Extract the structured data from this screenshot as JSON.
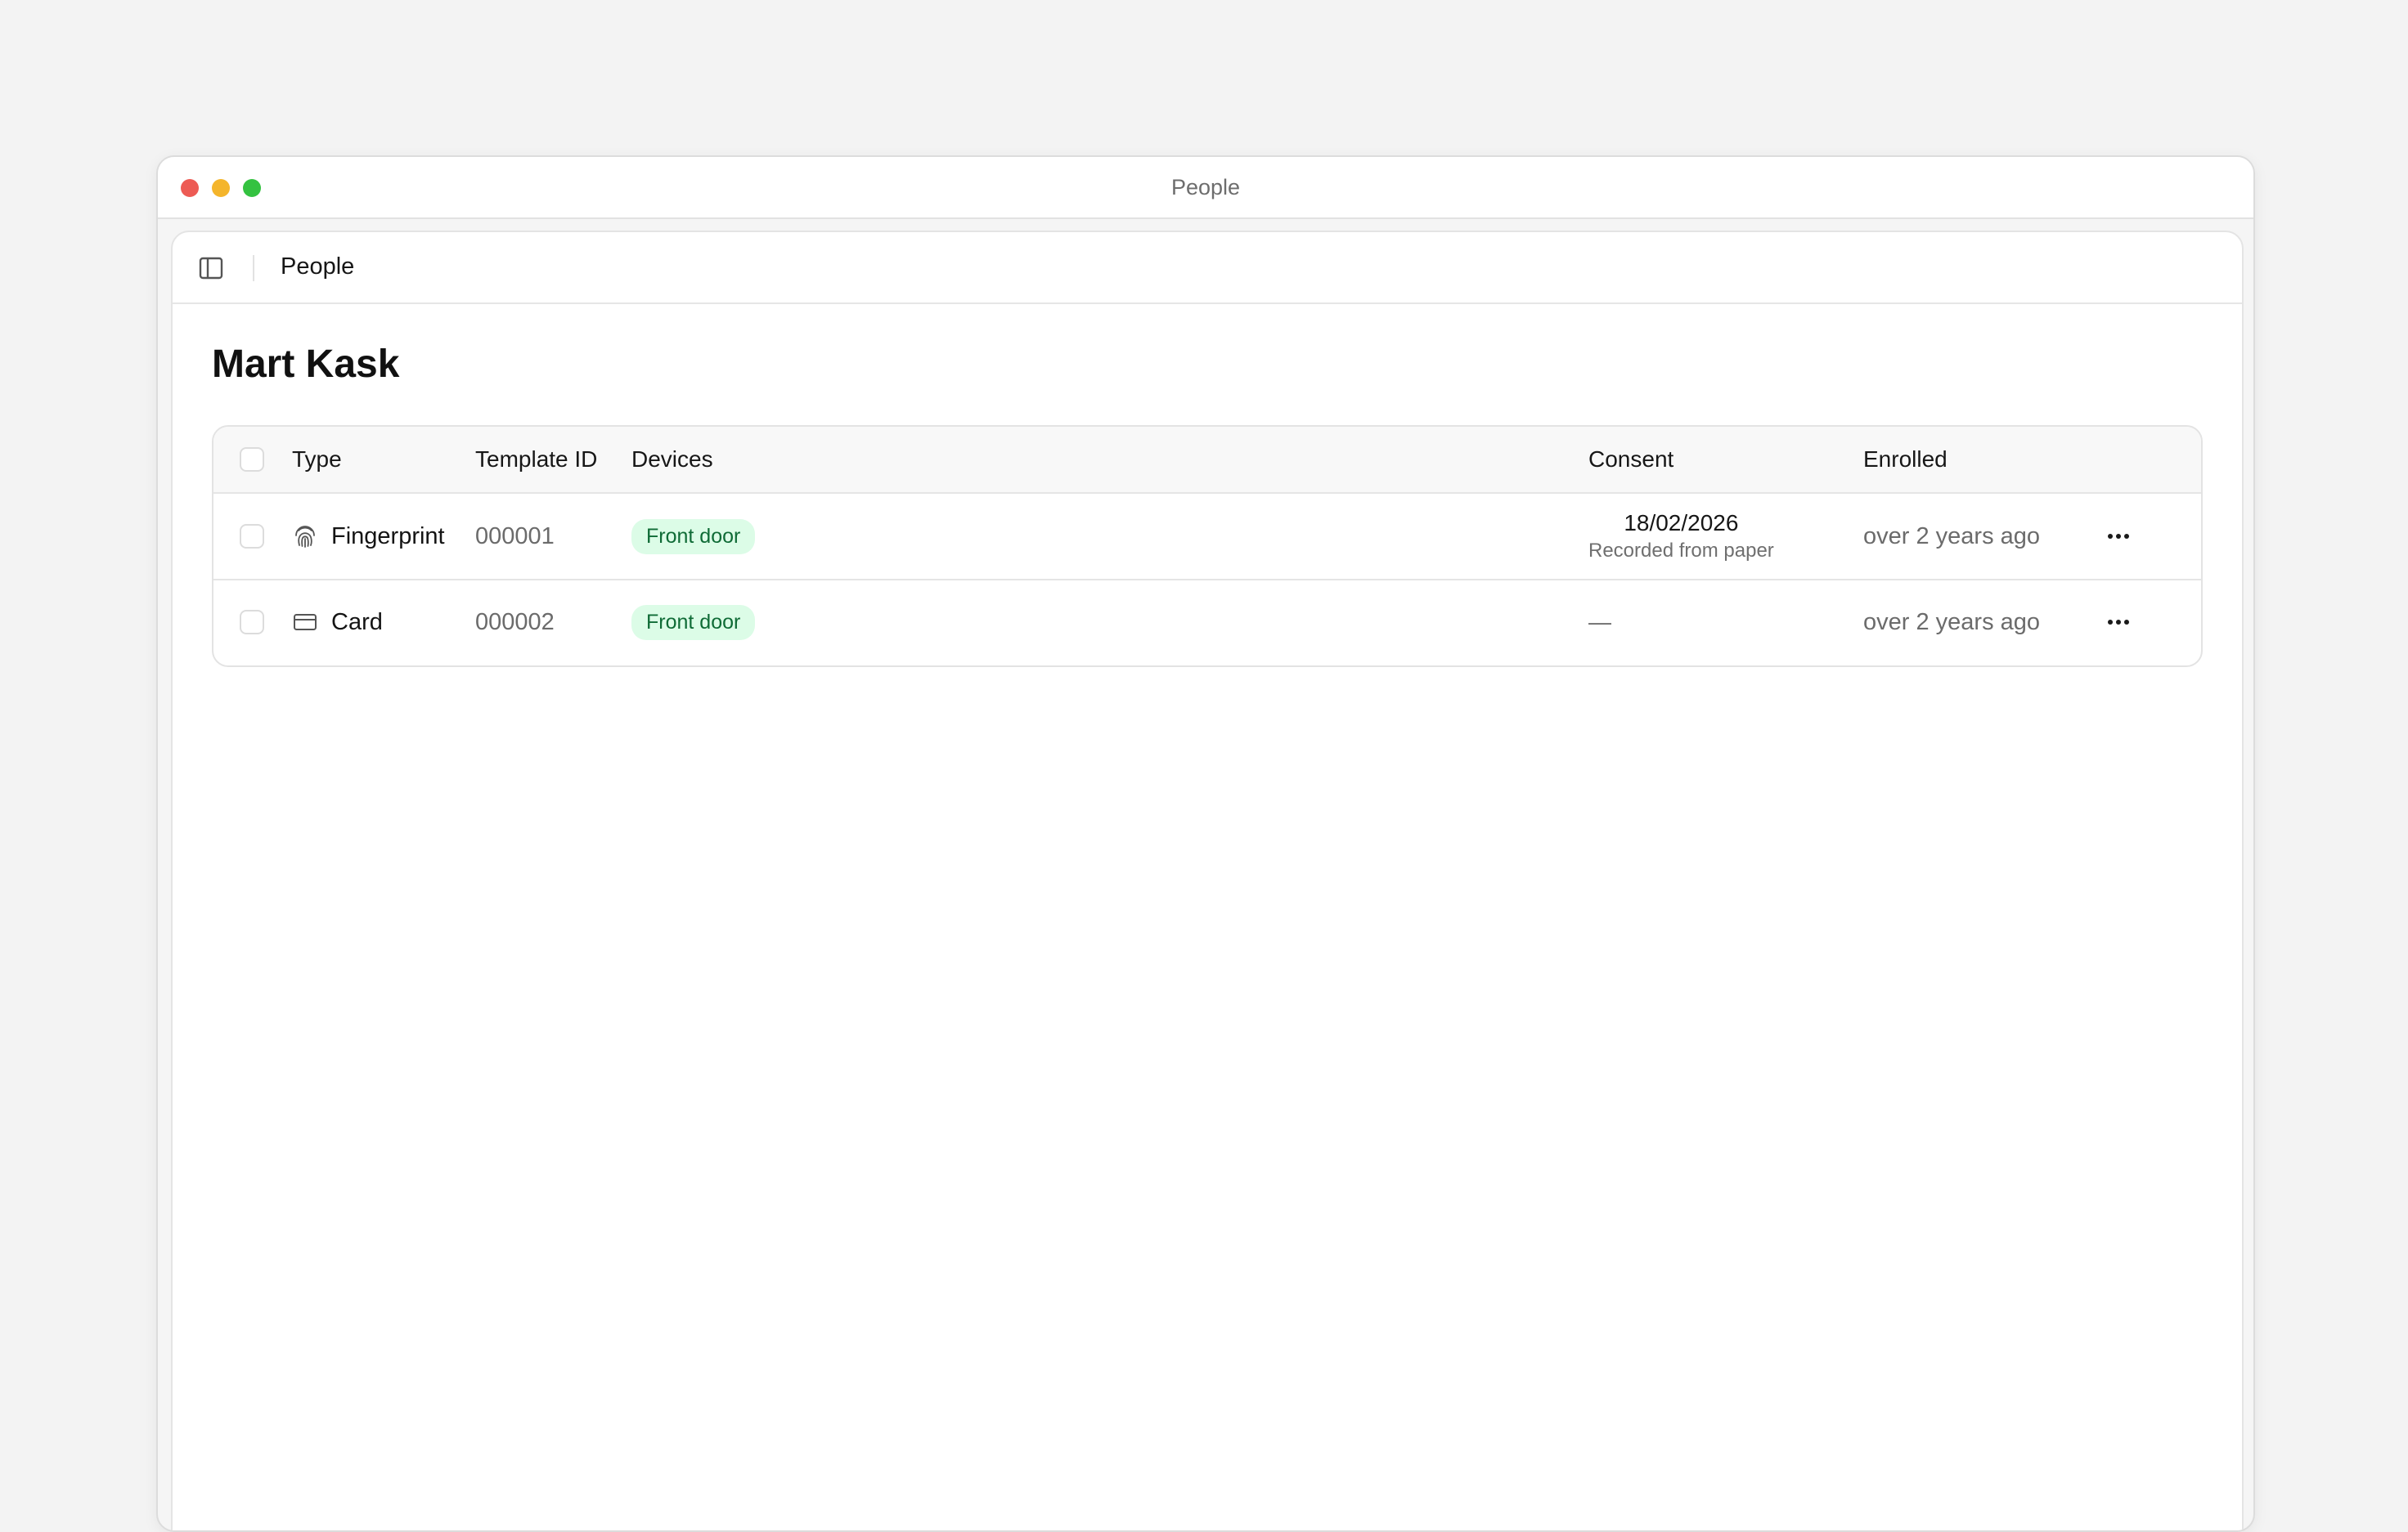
{
  "window": {
    "title": "People"
  },
  "toolbar": {
    "sidebar_toggle_icon": "sidebar-panel-icon",
    "breadcrumb": "People"
  },
  "page": {
    "title": "Mart Kask"
  },
  "table": {
    "columns": {
      "type": "Type",
      "template_id": "Template ID",
      "devices": "Devices",
      "consent": "Consent",
      "enrolled": "Enrolled"
    },
    "rows": [
      {
        "type_icon": "fingerprint-icon",
        "type": "Fingerprint",
        "template_id": "000001",
        "device": "Front door",
        "consent_date": "18/02/2026",
        "consent_note": "Recorded from paper",
        "enrolled": "over 2 years ago",
        "actions_icon": "more-horizontal-icon"
      },
      {
        "type_icon": "card-icon",
        "type": "Card",
        "template_id": "000002",
        "device": "Front door",
        "consent_date": "—",
        "enrolled": "over 2 years ago",
        "actions_icon": "more-horizontal-icon"
      }
    ]
  },
  "colors": {
    "badge_bg": "#dcfce7",
    "badge_text": "#0f6b36",
    "traffic_red": "#ed5b54",
    "traffic_yellow": "#f4b52c",
    "traffic_green": "#34c240"
  }
}
